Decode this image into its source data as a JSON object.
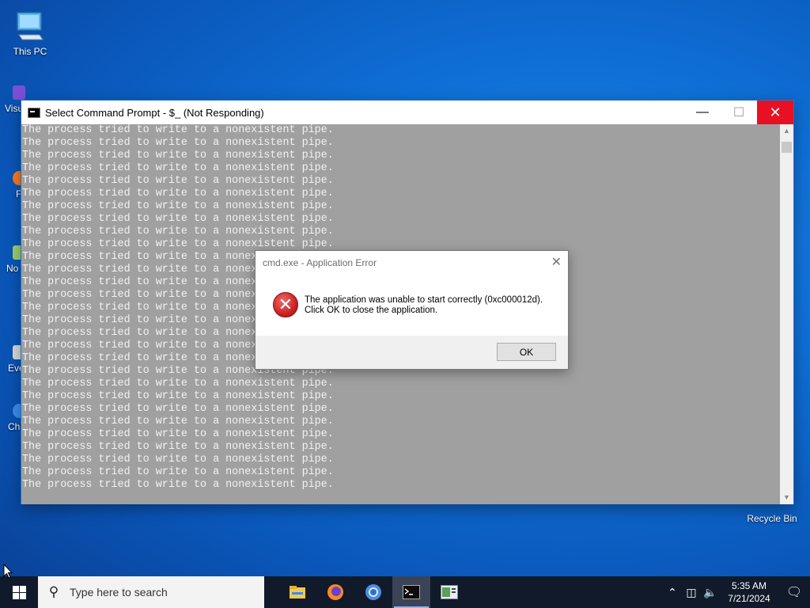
{
  "desktop": {
    "this_pc_label": "This PC",
    "recycle_bin_label": "Recycle Bin",
    "side_fragments": [
      "Visu",
      "F",
      "No",
      "Eve",
      "Ch"
    ]
  },
  "cmd": {
    "title": "Select Command Prompt - $_ (Not Responding)",
    "line": "The process tried to write to a nonexistent pipe.",
    "line_count": 29
  },
  "dialog": {
    "title": "cmd.exe - Application Error",
    "message_line1": "The application was unable to start correctly (0xc000012d).",
    "message_line2": "Click OK to close the application.",
    "ok_label": "OK"
  },
  "taskbar": {
    "search_placeholder": "Type here to search",
    "apps": [
      "file-explorer-icon",
      "firefox-icon",
      "chrome-icon",
      "command-prompt-icon",
      "task-manager-icon"
    ],
    "time": "5:35 AM",
    "date": "7/21/2024"
  },
  "colors": {
    "close_red": "#e81123",
    "console_bg": "#a0a0a0",
    "taskbar_bg": "#111a2a"
  }
}
